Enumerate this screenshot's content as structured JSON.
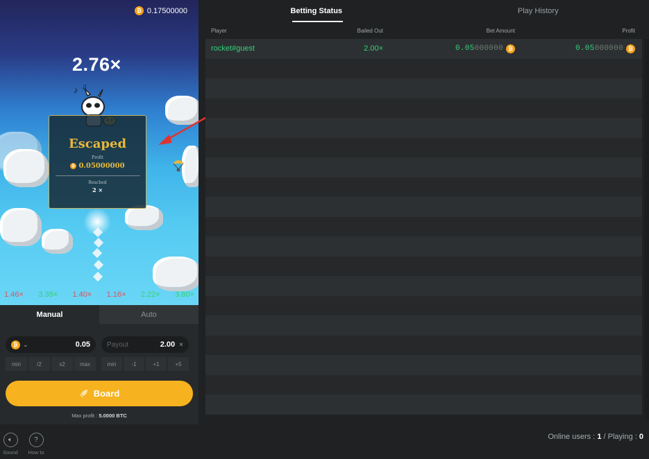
{
  "game": {
    "balance": "0.17500000",
    "multiplier": "2.76×",
    "escaped": {
      "title": "Escaped",
      "profit_label": "Profit",
      "profit_value": "0.05000000",
      "reached_label": "Reached",
      "reached_value": "2 ×"
    },
    "history": [
      {
        "value": "1.46×",
        "status": "lost"
      },
      {
        "value": "3.38×",
        "status": "won"
      },
      {
        "value": "1.40×",
        "status": "lost"
      },
      {
        "value": "1.16×",
        "status": "lost"
      },
      {
        "value": "2.22×",
        "status": "won"
      },
      {
        "value": "3.80×",
        "status": "won"
      }
    ]
  },
  "controls": {
    "tabs": [
      {
        "label": "Manual"
      },
      {
        "label": "Auto"
      }
    ],
    "amount_value": "0.05",
    "payout_label": "Payout",
    "payout_value": "2.00",
    "payout_suffix": "×",
    "amount_buttons": [
      "min",
      "/2",
      "x2",
      "max"
    ],
    "payout_buttons": [
      "min",
      "-1",
      "+1",
      "+5"
    ],
    "board_label": "Board",
    "max_profit_label": "Max profit :",
    "max_profit_value": "5.0000 BTC"
  },
  "footer": {
    "sound_label": "Sound",
    "howto_label": "How to"
  },
  "right_panel": {
    "tabs": [
      {
        "label": "Betting Status"
      },
      {
        "label": "Play History"
      }
    ],
    "columns": {
      "player": "Player",
      "bailed": "Bailed Out",
      "bet": "Bet Amount",
      "profit": "Profit"
    },
    "rows": [
      {
        "player": "rocket#guest",
        "bailed": "2.00×",
        "bet_hi": "0.05",
        "bet_lo": "000000",
        "profit_hi": "0.05",
        "profit_lo": "000000"
      }
    ],
    "online_label": "Online users :",
    "online_value": "1",
    "playing_label": "/ Playing :",
    "playing_value": "0"
  },
  "colors": {
    "accent": "#f6b21f",
    "win_green": "#36d17c",
    "loss_red": "#e0525a",
    "bitcoin": "#f6a21a"
  }
}
